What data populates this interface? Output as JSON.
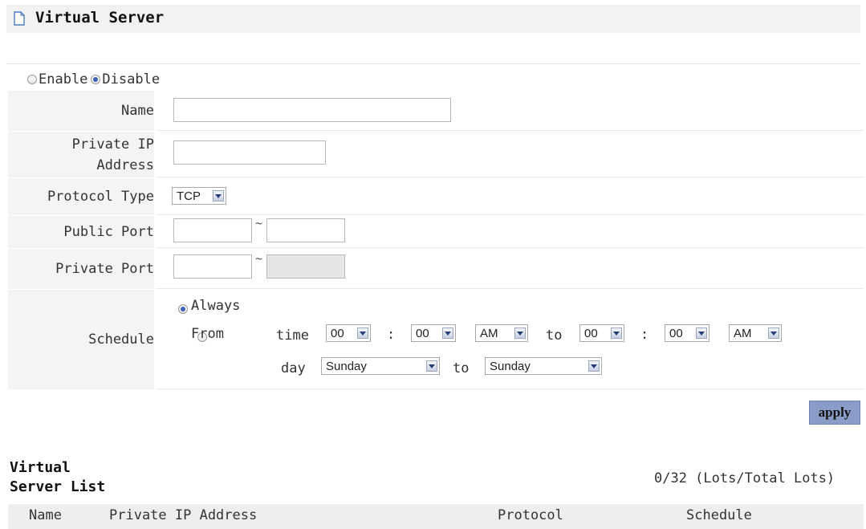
{
  "page": {
    "title": "Virtual Server"
  },
  "status": {
    "options": [
      {
        "label": "Enable",
        "checked": false
      },
      {
        "label": "Disable",
        "checked": true
      }
    ]
  },
  "form": {
    "name": {
      "label": "Name",
      "value": ""
    },
    "private_ip": {
      "label_line1": "Private IP",
      "label_line2": "Address",
      "value": ""
    },
    "protocol": {
      "label": "Protocol Type",
      "selected": "TCP"
    },
    "public_port": {
      "label": "Public Port",
      "from": "",
      "to": "",
      "separator": "~"
    },
    "private_port": {
      "label": "Private Port",
      "from": "",
      "to": "",
      "separator": "~"
    },
    "schedule": {
      "label": "Schedule",
      "always_label": "Always",
      "from_label": "From",
      "always_checked": true,
      "time_label": "time",
      "colon": ":",
      "to_label": "to",
      "day_label": "day",
      "start_hour": "00",
      "start_minute": "00",
      "start_ampm": "AM",
      "end_hour": "00",
      "end_minute": "00",
      "end_ampm": "AM",
      "start_day": "Sunday",
      "end_day": "Sunday"
    }
  },
  "actions": {
    "apply_label": "apply"
  },
  "list": {
    "title_line1": "Virtual",
    "title_line2": "Server List",
    "count": "0/32 (Lots/Total Lots)",
    "columns": [
      "Name",
      "Private IP Address",
      "Protocol",
      "Schedule"
    ]
  }
}
